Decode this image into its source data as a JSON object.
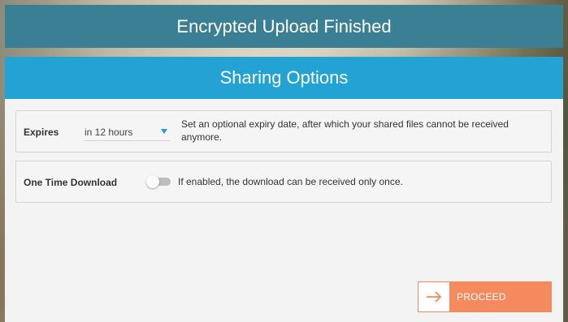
{
  "banner": {
    "title": "Encrypted Upload Finished"
  },
  "panel": {
    "title": "Sharing Options"
  },
  "expires": {
    "label": "Expires",
    "selected": "in 12 hours",
    "description": "Set an optional expiry date, after which your shared files cannot be received anymore."
  },
  "one_time": {
    "label": "One Time Download",
    "enabled": false,
    "description": "If enabled, the download can be received only once."
  },
  "proceed": {
    "label": "PROCEED",
    "icon": "arrow-right-icon"
  },
  "colors": {
    "banner": "#3a7f93",
    "header": "#23a3d3",
    "accent": "#f58a5f",
    "dropdown_arrow": "#1e9bd0"
  }
}
